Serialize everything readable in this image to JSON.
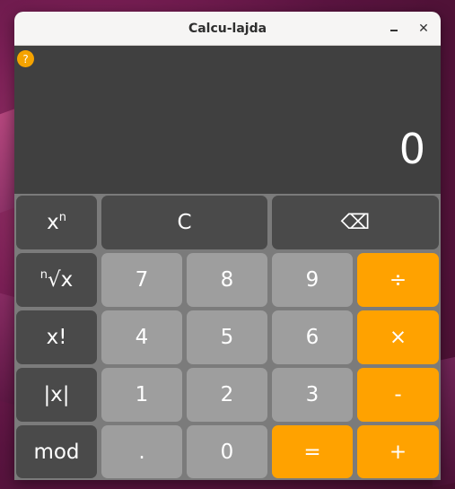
{
  "window": {
    "title": "Calcu-lajda"
  },
  "titlebar": {
    "minimize_label": "–",
    "close_label": "✕"
  },
  "display": {
    "help_label": "?",
    "result": "0"
  },
  "keys": {
    "power_base": "x",
    "power_exp": "n",
    "clear": "C",
    "backspace": "⌫",
    "root_index": "n",
    "root_body": "√x",
    "factorial": "x!",
    "abs": "|x|",
    "mod": "mod",
    "digit_7": "7",
    "digit_8": "8",
    "digit_9": "9",
    "divide": "÷",
    "digit_4": "4",
    "digit_5": "5",
    "digit_6": "6",
    "multiply": "×",
    "digit_1": "1",
    "digit_2": "2",
    "digit_3": "3",
    "subtract": "-",
    "decimal": ".",
    "digit_0": "0",
    "equals": "=",
    "add": "+"
  },
  "colors": {
    "accent": "#ffa200",
    "function_key": "#4a4a4a",
    "number_key": "#9e9e9e",
    "display_bg": "#404040"
  }
}
